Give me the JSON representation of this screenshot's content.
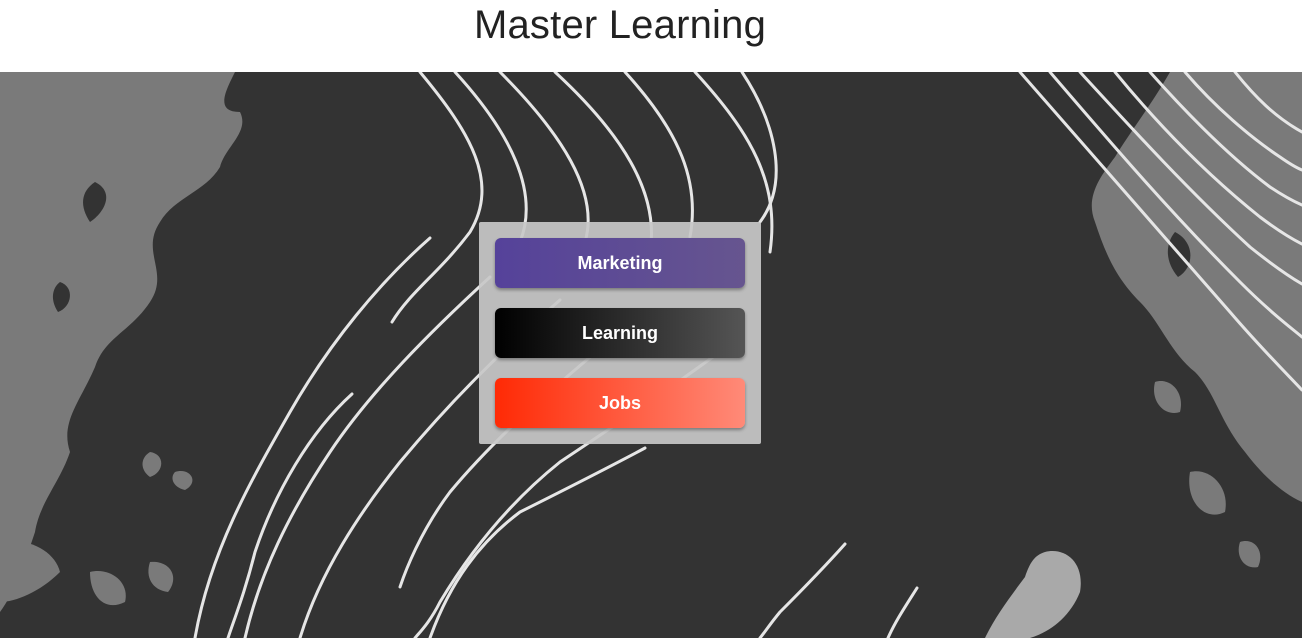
{
  "header": {
    "title": "Master Learning"
  },
  "hero": {
    "background_color": "#333333",
    "land_color": "#777777",
    "line_color": "#e6e6e6",
    "image": "map-streamlines-background"
  },
  "menu": {
    "buttons": [
      {
        "label": "Marketing",
        "color_start": "#55429a",
        "color_end": "#66558f"
      },
      {
        "label": "Learning",
        "color_start": "#000000",
        "color_end": "#555555"
      },
      {
        "label": "Jobs",
        "color_start": "#ff2a05",
        "color_end": "#ff8a78"
      }
    ]
  }
}
